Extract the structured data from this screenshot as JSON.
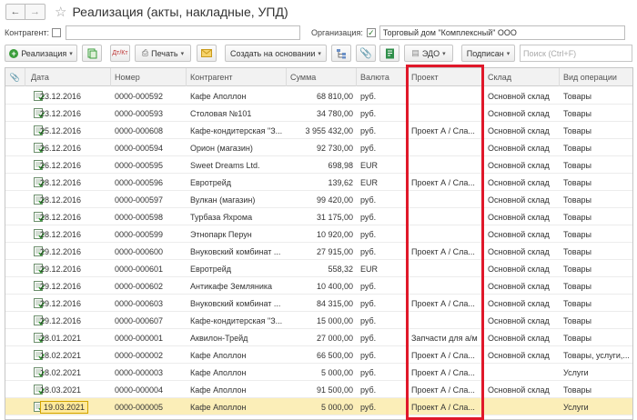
{
  "window": {
    "title": "Реализация (акты, накладные, УПД)"
  },
  "filters": {
    "counterparty_label": "Контрагент:",
    "counterparty_value": "",
    "organization_label": "Организация:",
    "organization_checked": "✓",
    "organization_value": "Торговый дом \"Комплексный\" ООО"
  },
  "toolbar": {
    "create_label": "Реализация",
    "print_label": "Печать",
    "create_based_label": "Создать на основании",
    "edo_label": "ЭДО",
    "sign_label": "Подписан",
    "search_placeholder": "Поиск (Ctrl+F)",
    "dtkt_label": "Дт/Кт"
  },
  "table": {
    "columns": [
      "Дата",
      "Номер",
      "Контрагент",
      "Сумма",
      "Валюта",
      "Проект",
      "Склад",
      "Вид операции"
    ],
    "rows": [
      {
        "date": "23.12.2016",
        "number": "0000-000592",
        "counterparty": "Кафе Аполлон",
        "sum": "68 810,00",
        "currency": "руб.",
        "project": "",
        "warehouse": "Основной склад",
        "operation": "Товары"
      },
      {
        "date": "23.12.2016",
        "number": "0000-000593",
        "counterparty": "Столовая №101",
        "sum": "34 780,00",
        "currency": "руб.",
        "project": "",
        "warehouse": "Основной склад",
        "operation": "Товары"
      },
      {
        "date": "25.12.2016",
        "number": "0000-000608",
        "counterparty": "Кафе-кондитерская \"З...",
        "sum": "3 955 432,00",
        "currency": "руб.",
        "project": "Проект А / Сла...",
        "warehouse": "Основной склад",
        "operation": "Товары"
      },
      {
        "date": "26.12.2016",
        "number": "0000-000594",
        "counterparty": "Орион (магазин)",
        "sum": "92 730,00",
        "currency": "руб.",
        "project": "",
        "warehouse": "Основной склад",
        "operation": "Товары"
      },
      {
        "date": "26.12.2016",
        "number": "0000-000595",
        "counterparty": "Sweet Dreams Ltd.",
        "sum": "698,98",
        "currency": "EUR",
        "project": "",
        "warehouse": "Основной склад",
        "operation": "Товары"
      },
      {
        "date": "28.12.2016",
        "number": "0000-000596",
        "counterparty": "Евротрейд",
        "sum": "139,62",
        "currency": "EUR",
        "project": "Проект А / Сла...",
        "warehouse": "Основной склад",
        "operation": "Товары"
      },
      {
        "date": "28.12.2016",
        "number": "0000-000597",
        "counterparty": "Вулкан (магазин)",
        "sum": "99 420,00",
        "currency": "руб.",
        "project": "",
        "warehouse": "Основной склад",
        "operation": "Товары"
      },
      {
        "date": "28.12.2016",
        "number": "0000-000598",
        "counterparty": "Турбаза Яхрома",
        "sum": "31 175,00",
        "currency": "руб.",
        "project": "",
        "warehouse": "Основной склад",
        "operation": "Товары"
      },
      {
        "date": "28.12.2016",
        "number": "0000-000599",
        "counterparty": "Этнопарк Перун",
        "sum": "10 920,00",
        "currency": "руб.",
        "project": "",
        "warehouse": "Основной склад",
        "operation": "Товары"
      },
      {
        "date": "29.12.2016",
        "number": "0000-000600",
        "counterparty": "Внуковский комбинат ...",
        "sum": "27 915,00",
        "currency": "руб.",
        "project": "Проект А / Сла...",
        "warehouse": "Основной склад",
        "operation": "Товары"
      },
      {
        "date": "29.12.2016",
        "number": "0000-000601",
        "counterparty": "Евротрейд",
        "sum": "558,32",
        "currency": "EUR",
        "project": "",
        "warehouse": "Основной склад",
        "operation": "Товары"
      },
      {
        "date": "29.12.2016",
        "number": "0000-000602",
        "counterparty": "Антикафе Земляника",
        "sum": "10 400,00",
        "currency": "руб.",
        "project": "",
        "warehouse": "Основной склад",
        "operation": "Товары"
      },
      {
        "date": "29.12.2016",
        "number": "0000-000603",
        "counterparty": "Внуковский комбинат ...",
        "sum": "84 315,00",
        "currency": "руб.",
        "project": "Проект А / Сла...",
        "warehouse": "Основной склад",
        "operation": "Товары"
      },
      {
        "date": "29.12.2016",
        "number": "0000-000607",
        "counterparty": "Кафе-кондитерская \"З...",
        "sum": "15 000,00",
        "currency": "руб.",
        "project": "",
        "warehouse": "Основной склад",
        "operation": "Товары"
      },
      {
        "date": "28.01.2021",
        "number": "0000-000001",
        "counterparty": "Аквилон-Трейд",
        "sum": "27 000,00",
        "currency": "руб.",
        "project": "Запчасти для а/м",
        "warehouse": "Основной склад",
        "operation": "Товары"
      },
      {
        "date": "18.02.2021",
        "number": "0000-000002",
        "counterparty": "Кафе Аполлон",
        "sum": "66 500,00",
        "currency": "руб.",
        "project": "Проект А / Сла...",
        "warehouse": "Основной склад",
        "operation": "Товары, услуги,..."
      },
      {
        "date": "18.02.2021",
        "number": "0000-000003",
        "counterparty": "Кафе Аполлон",
        "sum": "5 000,00",
        "currency": "руб.",
        "project": "Проект А / Сла...",
        "warehouse": "",
        "operation": "Услуги"
      },
      {
        "date": "18.03.2021",
        "number": "0000-000004",
        "counterparty": "Кафе Аполлон",
        "sum": "91 500,00",
        "currency": "руб.",
        "project": "Проект А / Сла...",
        "warehouse": "Основной склад",
        "operation": "Товары"
      },
      {
        "date": "19.03.2021",
        "number": "0000-000005",
        "counterparty": "Кафе Аполлон",
        "sum": "5 000,00",
        "currency": "руб.",
        "project": "Проект А / Сла...",
        "warehouse": "",
        "operation": "Услуги"
      }
    ]
  },
  "colors": {
    "highlight": "#e0182a",
    "selected_row": "#fbeeb8",
    "doc_icon": "#3a9d3a"
  }
}
